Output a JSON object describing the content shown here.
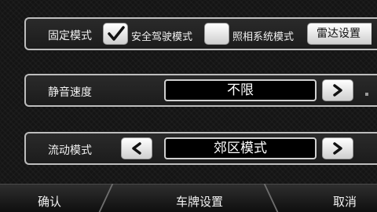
{
  "row1": {
    "fixed_mode_label": "固定模式",
    "safe_driving_label": "安全驾驶模式",
    "safe_driving_checked": true,
    "camera_system_label": "照相系统模式",
    "camera_system_checked": false,
    "radar_button_label": "雷达设置"
  },
  "row2": {
    "label": "静音速度",
    "value": "不限"
  },
  "row3": {
    "label": "流动模式",
    "value": "郊区模式"
  },
  "bottom": {
    "confirm_label": "确认",
    "plate_settings_label": "车牌设置",
    "cancel_label": "取消"
  },
  "icons": {
    "check": "checkmark-icon",
    "next": "chevron-right-icon",
    "prev": "chevron-left-icon"
  }
}
